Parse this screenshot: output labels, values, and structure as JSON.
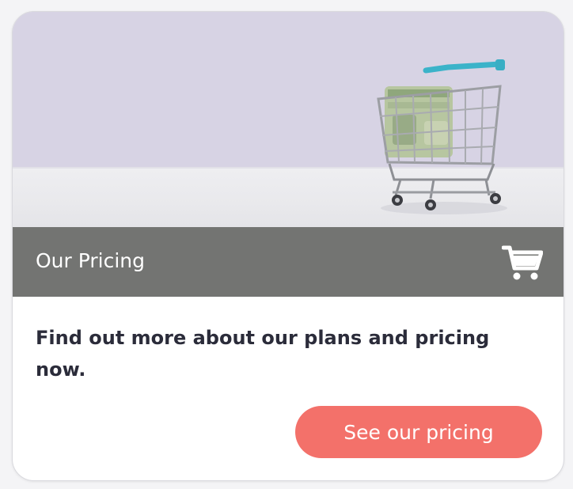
{
  "card": {
    "title": "Our Pricing",
    "description": "Find out more about our plans and pricing now.",
    "cta_label": "See our pricing",
    "title_icon": "shopping-cart-icon",
    "hero_image": "shopping-cart-with-money-photo"
  },
  "colors": {
    "title_bar": "#737472",
    "cta": "#f3716a",
    "text": "#2b2c3a",
    "hero_background": "#d7d3e4"
  }
}
